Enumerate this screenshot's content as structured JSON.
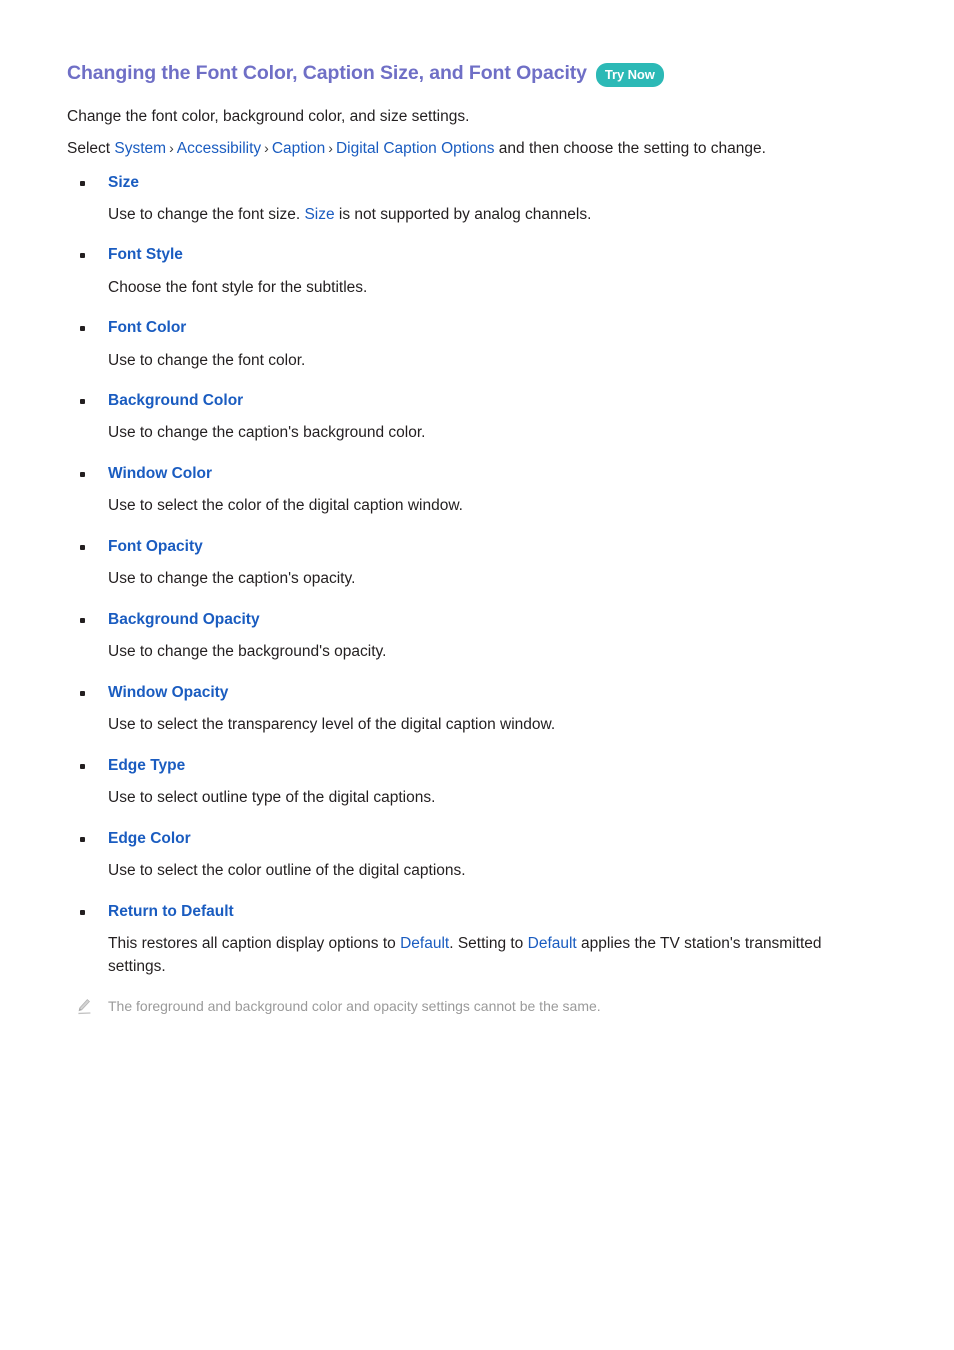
{
  "header": {
    "title": "Changing the Font Color, Caption Size, and Font Opacity",
    "badge": "Try Now",
    "title_color": "#6f6fc6",
    "badge_color": "#2cb9b6"
  },
  "intro": {
    "lead": "Change the font color, background color, and size settings.",
    "select_prefix": "Select ",
    "breadcrumb": [
      "System",
      "Accessibility",
      "Caption",
      "Digital Caption Options"
    ],
    "separator": "›",
    "select_suffix": " and then choose the setting to change."
  },
  "options": [
    {
      "term": "Size",
      "desc_before": "Use to change the font size. ",
      "desc_link": "Size",
      "desc_after": " is not supported by analog channels."
    },
    {
      "term": "Font Style",
      "desc_before": "Choose the font style for the subtitles.",
      "desc_link": "",
      "desc_after": ""
    },
    {
      "term": "Font Color",
      "desc_before": "Use to change the font color.",
      "desc_link": "",
      "desc_after": ""
    },
    {
      "term": "Background Color",
      "desc_before": "Use to change the caption's background color.",
      "desc_link": "",
      "desc_after": ""
    },
    {
      "term": "Window Color",
      "desc_before": "Use to select the color of the digital caption window.",
      "desc_link": "",
      "desc_after": ""
    },
    {
      "term": "Font Opacity",
      "desc_before": "Use to change the caption's opacity.",
      "desc_link": "",
      "desc_after": ""
    },
    {
      "term": "Background Opacity",
      "desc_before": "Use to change the background's opacity.",
      "desc_link": "",
      "desc_after": ""
    },
    {
      "term": "Window Opacity",
      "desc_before": "Use to select the transparency level of the digital caption window.",
      "desc_link": "",
      "desc_after": ""
    },
    {
      "term": "Edge Type",
      "desc_before": "Use to select outline type of the digital captions.",
      "desc_link": "",
      "desc_after": ""
    },
    {
      "term": "Edge Color",
      "desc_before": "Use to select the color outline of the digital captions.",
      "desc_link": "",
      "desc_after": ""
    },
    {
      "term": "Return to Default",
      "desc_before": "This restores all caption display options to ",
      "desc_link": "Default",
      "desc_mid": ". Setting to ",
      "desc_link2": "Default",
      "desc_after": " applies the TV station's transmitted settings."
    }
  ],
  "note": {
    "icon": "pencil-icon",
    "text": "The foreground and background color and opacity settings cannot be the same."
  },
  "colors": {
    "link": "#1a5cc0",
    "body_text": "#231f20",
    "note_text": "#9a9a9a",
    "background": "#ffffff"
  }
}
